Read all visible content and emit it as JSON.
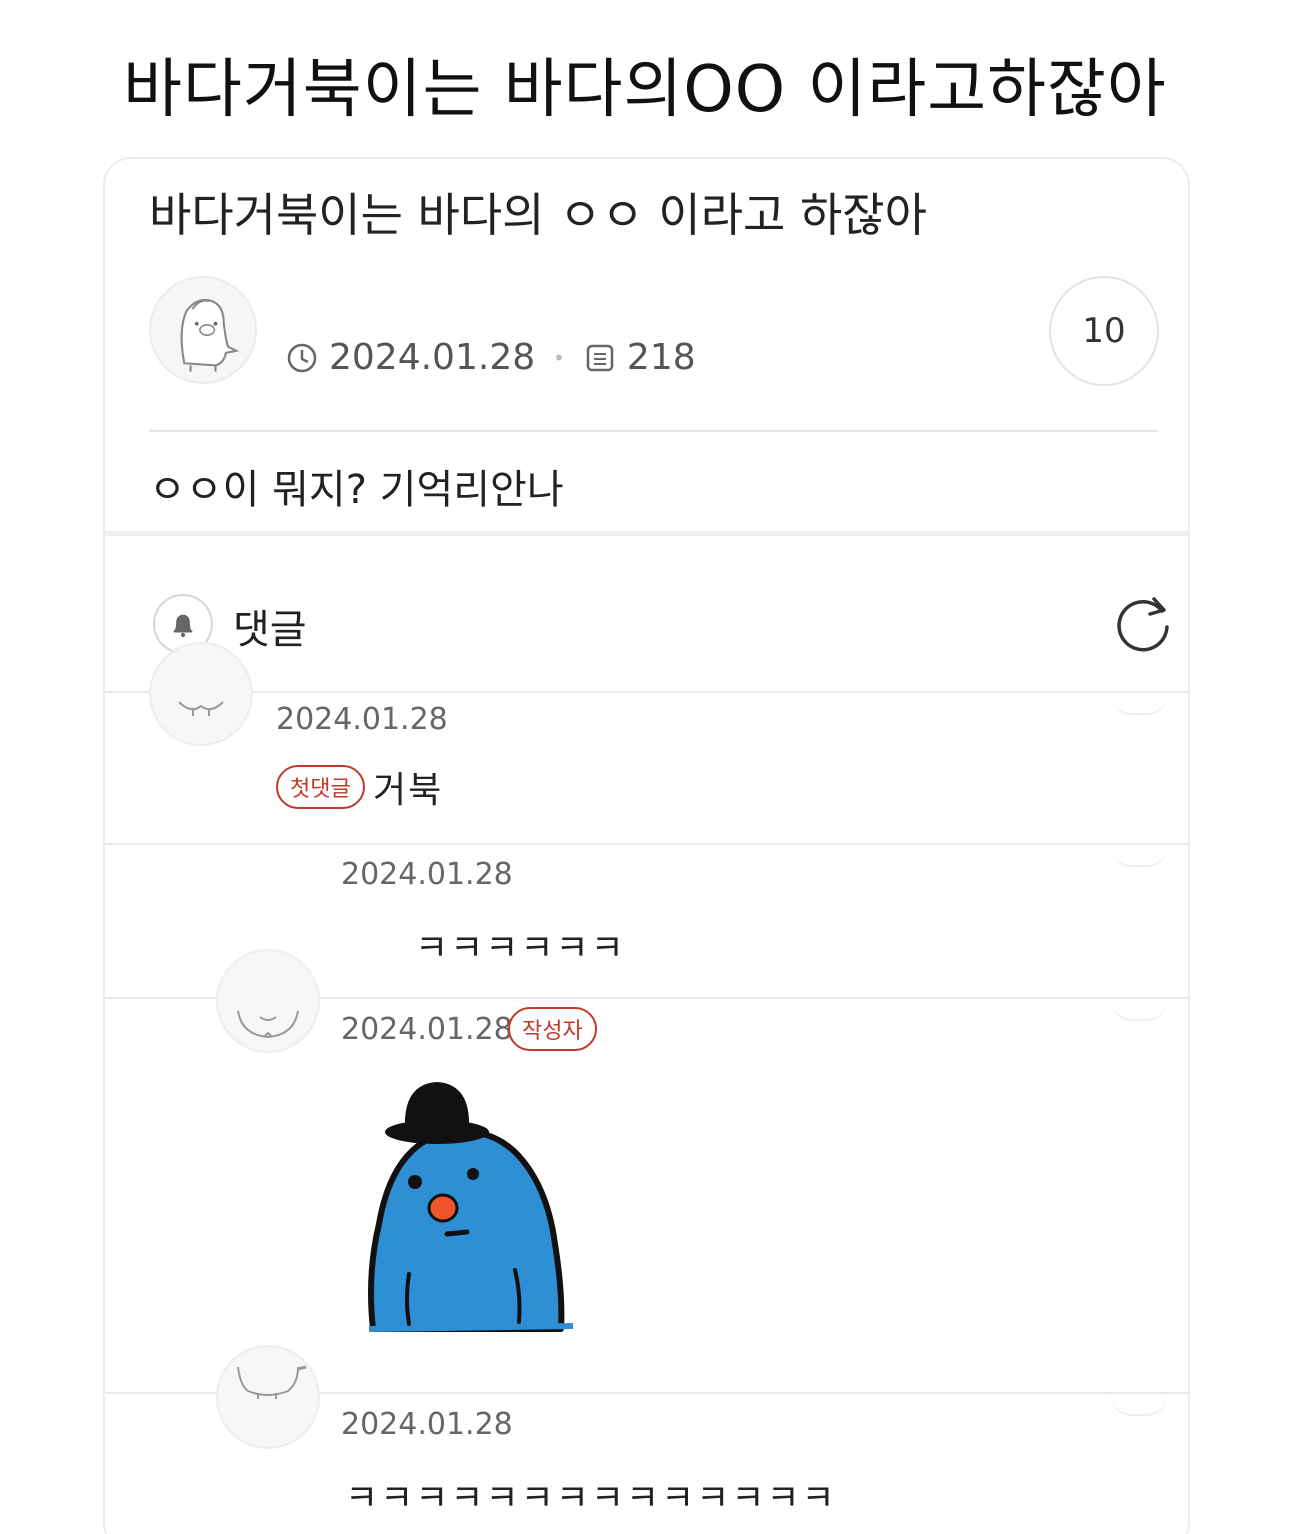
{
  "headline": "바다거북이는 바다의OO 이라고하잖아",
  "post": {
    "title": "바다거북이는 바다의 ㅇㅇ 이라고 하잖아",
    "date": "2024.01.28",
    "views": "218",
    "comment_count": "10",
    "body": "ㅇㅇ이 뭐지? 기억리안나"
  },
  "comments_section": {
    "label": "댓글"
  },
  "comments": [
    {
      "date": "2024.01.28",
      "badge": "첫댓글",
      "text": "거북"
    },
    {
      "date": "2024.01.28",
      "text": "ㅋㅋㅋㅋㅋㅋ"
    },
    {
      "date": "2024.01.28",
      "badge": "작성자",
      "sticker": "blue-bird-bowler-hat-sticker"
    },
    {
      "date": "2024.01.28",
      "text": "ㅋㅋㅋㅋㅋㅋㅋㅋㅋㅋㅋㅋㅋㅋ"
    }
  ],
  "colors": {
    "badge_red": "#c0392b",
    "sticker_blue": "#2f8fd4",
    "divider": "#e8e8e8"
  },
  "icons": [
    "clock-icon",
    "document-icon",
    "bell-icon",
    "refresh-icon",
    "avatar-icon"
  ]
}
